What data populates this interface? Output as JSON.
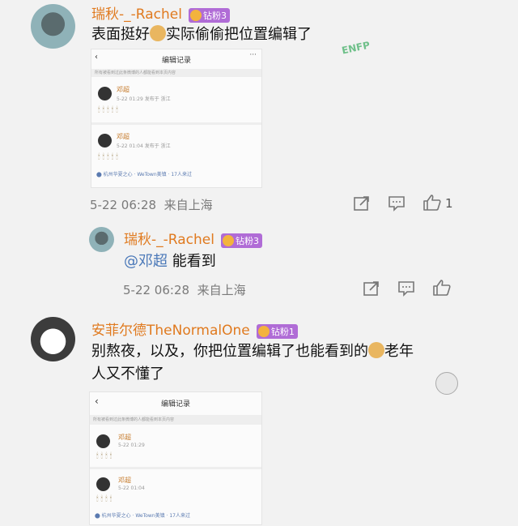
{
  "comments": [
    {
      "username": "瑞秋-_-Rachel",
      "badge": "钻粉3",
      "text_a": "表面挺好",
      "text_b": "实际偷偷把位置编辑了",
      "sticker": "ENFP",
      "time": "5-22 06:28",
      "source": "来自上海",
      "likes": "1"
    },
    {
      "username": "瑞秋-_-Rachel",
      "badge": "钻粉3",
      "mention": "@邓超",
      "text": "能看到",
      "time": "5-22 06:28",
      "source": "来自上海"
    },
    {
      "username": "安菲尔德TheNormalOne",
      "badge": "钻粉1",
      "text_a": "别熬夜，以及，你把位置编辑了也能看到的",
      "text_b": "老年",
      "text_c": "人又不懂了"
    }
  ],
  "embedded_1": {
    "title": "编辑记录",
    "notice": "所有被看到过此条微博的人都能看到本页内容",
    "entries": [
      {
        "name": "邓超",
        "time": "5-22 01:29  发布于 浙江"
      },
      {
        "name": "邓超",
        "time": "5-22 01:04  发布于 浙江"
      }
    ],
    "location": "杭州华夏之心 · WeTown美镇 · 17人来过"
  },
  "embedded_2": {
    "title": "编辑记录",
    "notice": "所有被看到过此条微博的人都能看到本页内容",
    "entries": [
      {
        "name": "邓超",
        "time": "5-22 01:29"
      },
      {
        "name": "邓超",
        "time": "5-22 01:04"
      }
    ],
    "location": "杭州华夏之心 · WeTown美镇 · 17人来过"
  },
  "icons": {
    "share": "share-icon",
    "reply": "comment-icon",
    "like": "thumbs-up-icon"
  },
  "colors": {
    "username": "#e07a1f",
    "badge": "#b06cd6",
    "mention": "#4a78b8",
    "meta": "#7a7a7a"
  }
}
